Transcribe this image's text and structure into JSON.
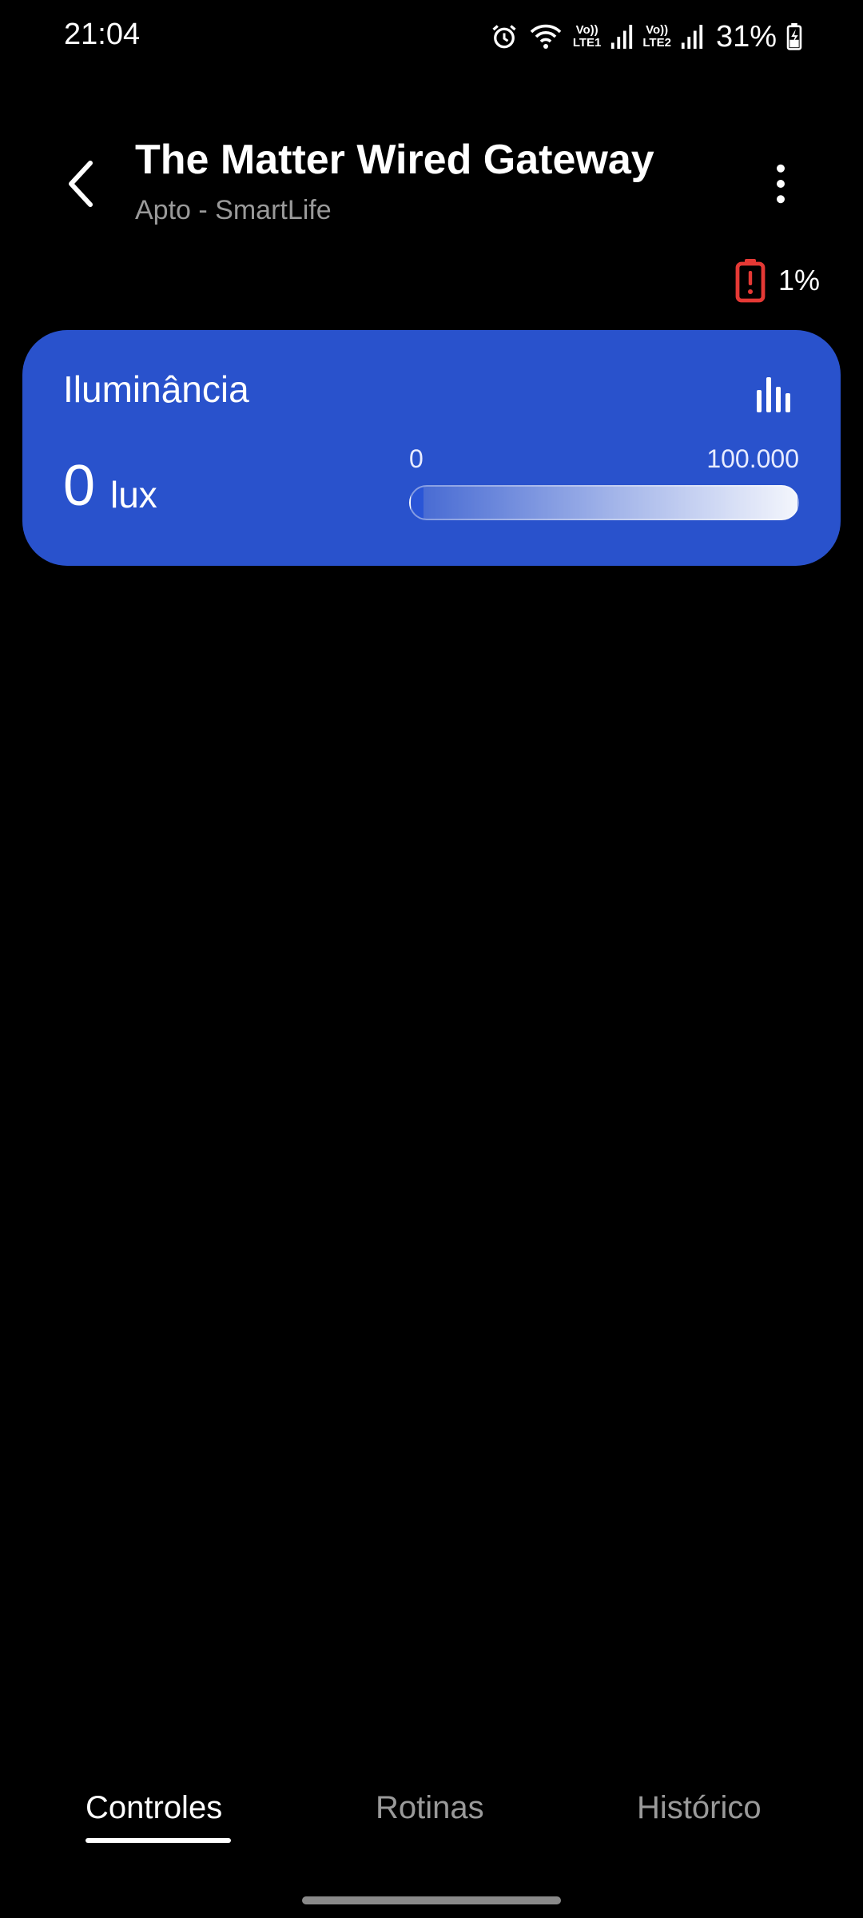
{
  "status_bar": {
    "time": "21:04",
    "network_1": "LTE1",
    "network_2": "LTE2",
    "volte_label": "Vo))",
    "battery_percent": "31%",
    "icons": [
      "alarm-icon",
      "wifi-icon",
      "signal-icon",
      "signal-icon",
      "battery-charging-icon"
    ]
  },
  "header": {
    "title": "The Matter Wired Gateway",
    "subtitle": "Apto - SmartLife",
    "back_icon": "chevron-left-icon",
    "more_icon": "more-vertical-icon"
  },
  "device_battery": {
    "level": "1%",
    "icon": "battery-warning-icon",
    "color": "#e53935"
  },
  "illuminance_card": {
    "title": "Iluminância",
    "value": "0",
    "unit": "lux",
    "range_min": "0",
    "range_max": "100.000",
    "level_fraction": 0,
    "color": "#2952cc",
    "chart_icon": "bar-chart-icon"
  },
  "tabs": [
    {
      "label": "Controles",
      "active": true
    },
    {
      "label": "Rotinas",
      "active": false
    },
    {
      "label": "Histórico",
      "active": false
    }
  ]
}
